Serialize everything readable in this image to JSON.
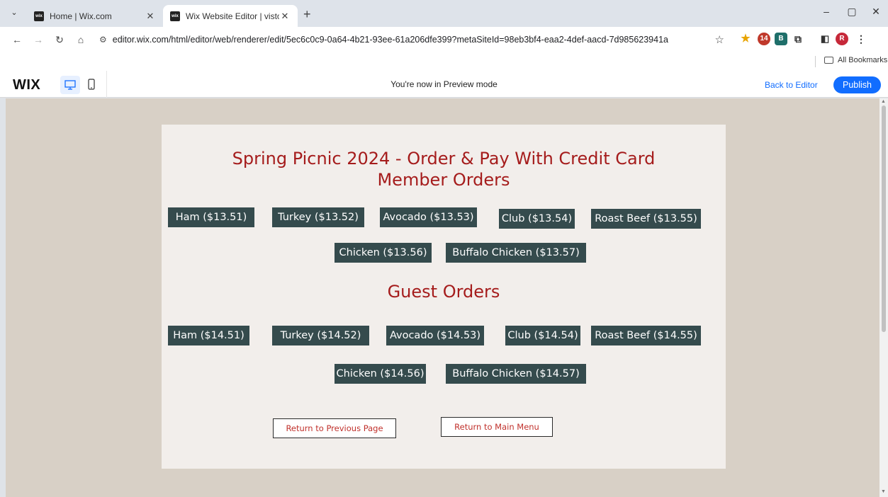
{
  "browser": {
    "tabs": [
      {
        "favicon": "wix",
        "title": "Home | Wix.com",
        "active": false
      },
      {
        "favicon": "wix",
        "title": "Wix Website Editor | vistosohik",
        "active": true
      }
    ],
    "new_tab": "+",
    "window_controls": [
      "–",
      "▢",
      "✕"
    ],
    "url": "editor.wix.com/html/editor/web/renderer/edit/5ec6c0c9-0a64-4b21-93ee-61a206dfe399?metaSiteId=98eb3bf4-eaa2-4def-aacd-7d985623941a",
    "extensions": [
      {
        "name": "extension-badge",
        "badge": "14",
        "color": "#c0392b"
      },
      {
        "name": "extension-b",
        "label": "B",
        "color": "#1f6f6a"
      }
    ],
    "profile_initial": "R",
    "bookmarks": {
      "all_bookmarks": "All Bookmarks"
    }
  },
  "wix_header": {
    "logo": "WIX",
    "preview_message": "You're now in Preview mode",
    "back_to_editor": "Back to Editor",
    "publish": "Publish"
  },
  "page": {
    "title_line1": "Spring Picnic 2024 - Order & Pay With Credit Card",
    "title_line2": "Member Orders",
    "guest_heading": "Guest Orders",
    "member_orders": [
      "Ham ($13.51)",
      "Turkey ($13.52)",
      "Avocado ($13.53)",
      "Club ($13.54)",
      "Roast Beef ($13.55)",
      "Chicken ($13.56)",
      "Buffalo Chicken ($13.57)"
    ],
    "guest_orders": [
      "Ham ($14.51)",
      "Turkey ($14.52)",
      "Avocado ($14.53)",
      "Club ($14.54)",
      "Roast Beef ($14.55)",
      "Chicken ($14.56)",
      "Buffalo Chicken ($14.57)"
    ],
    "return_previous": "Return to Previous Page",
    "return_main": "Return to Main Menu"
  },
  "colors": {
    "title_red": "#a51c1c",
    "button_bg": "#354b4d",
    "canvas_bg": "#d8d0c6",
    "panel_bg": "#f2eeeb",
    "wix_blue": "#116dff"
  }
}
